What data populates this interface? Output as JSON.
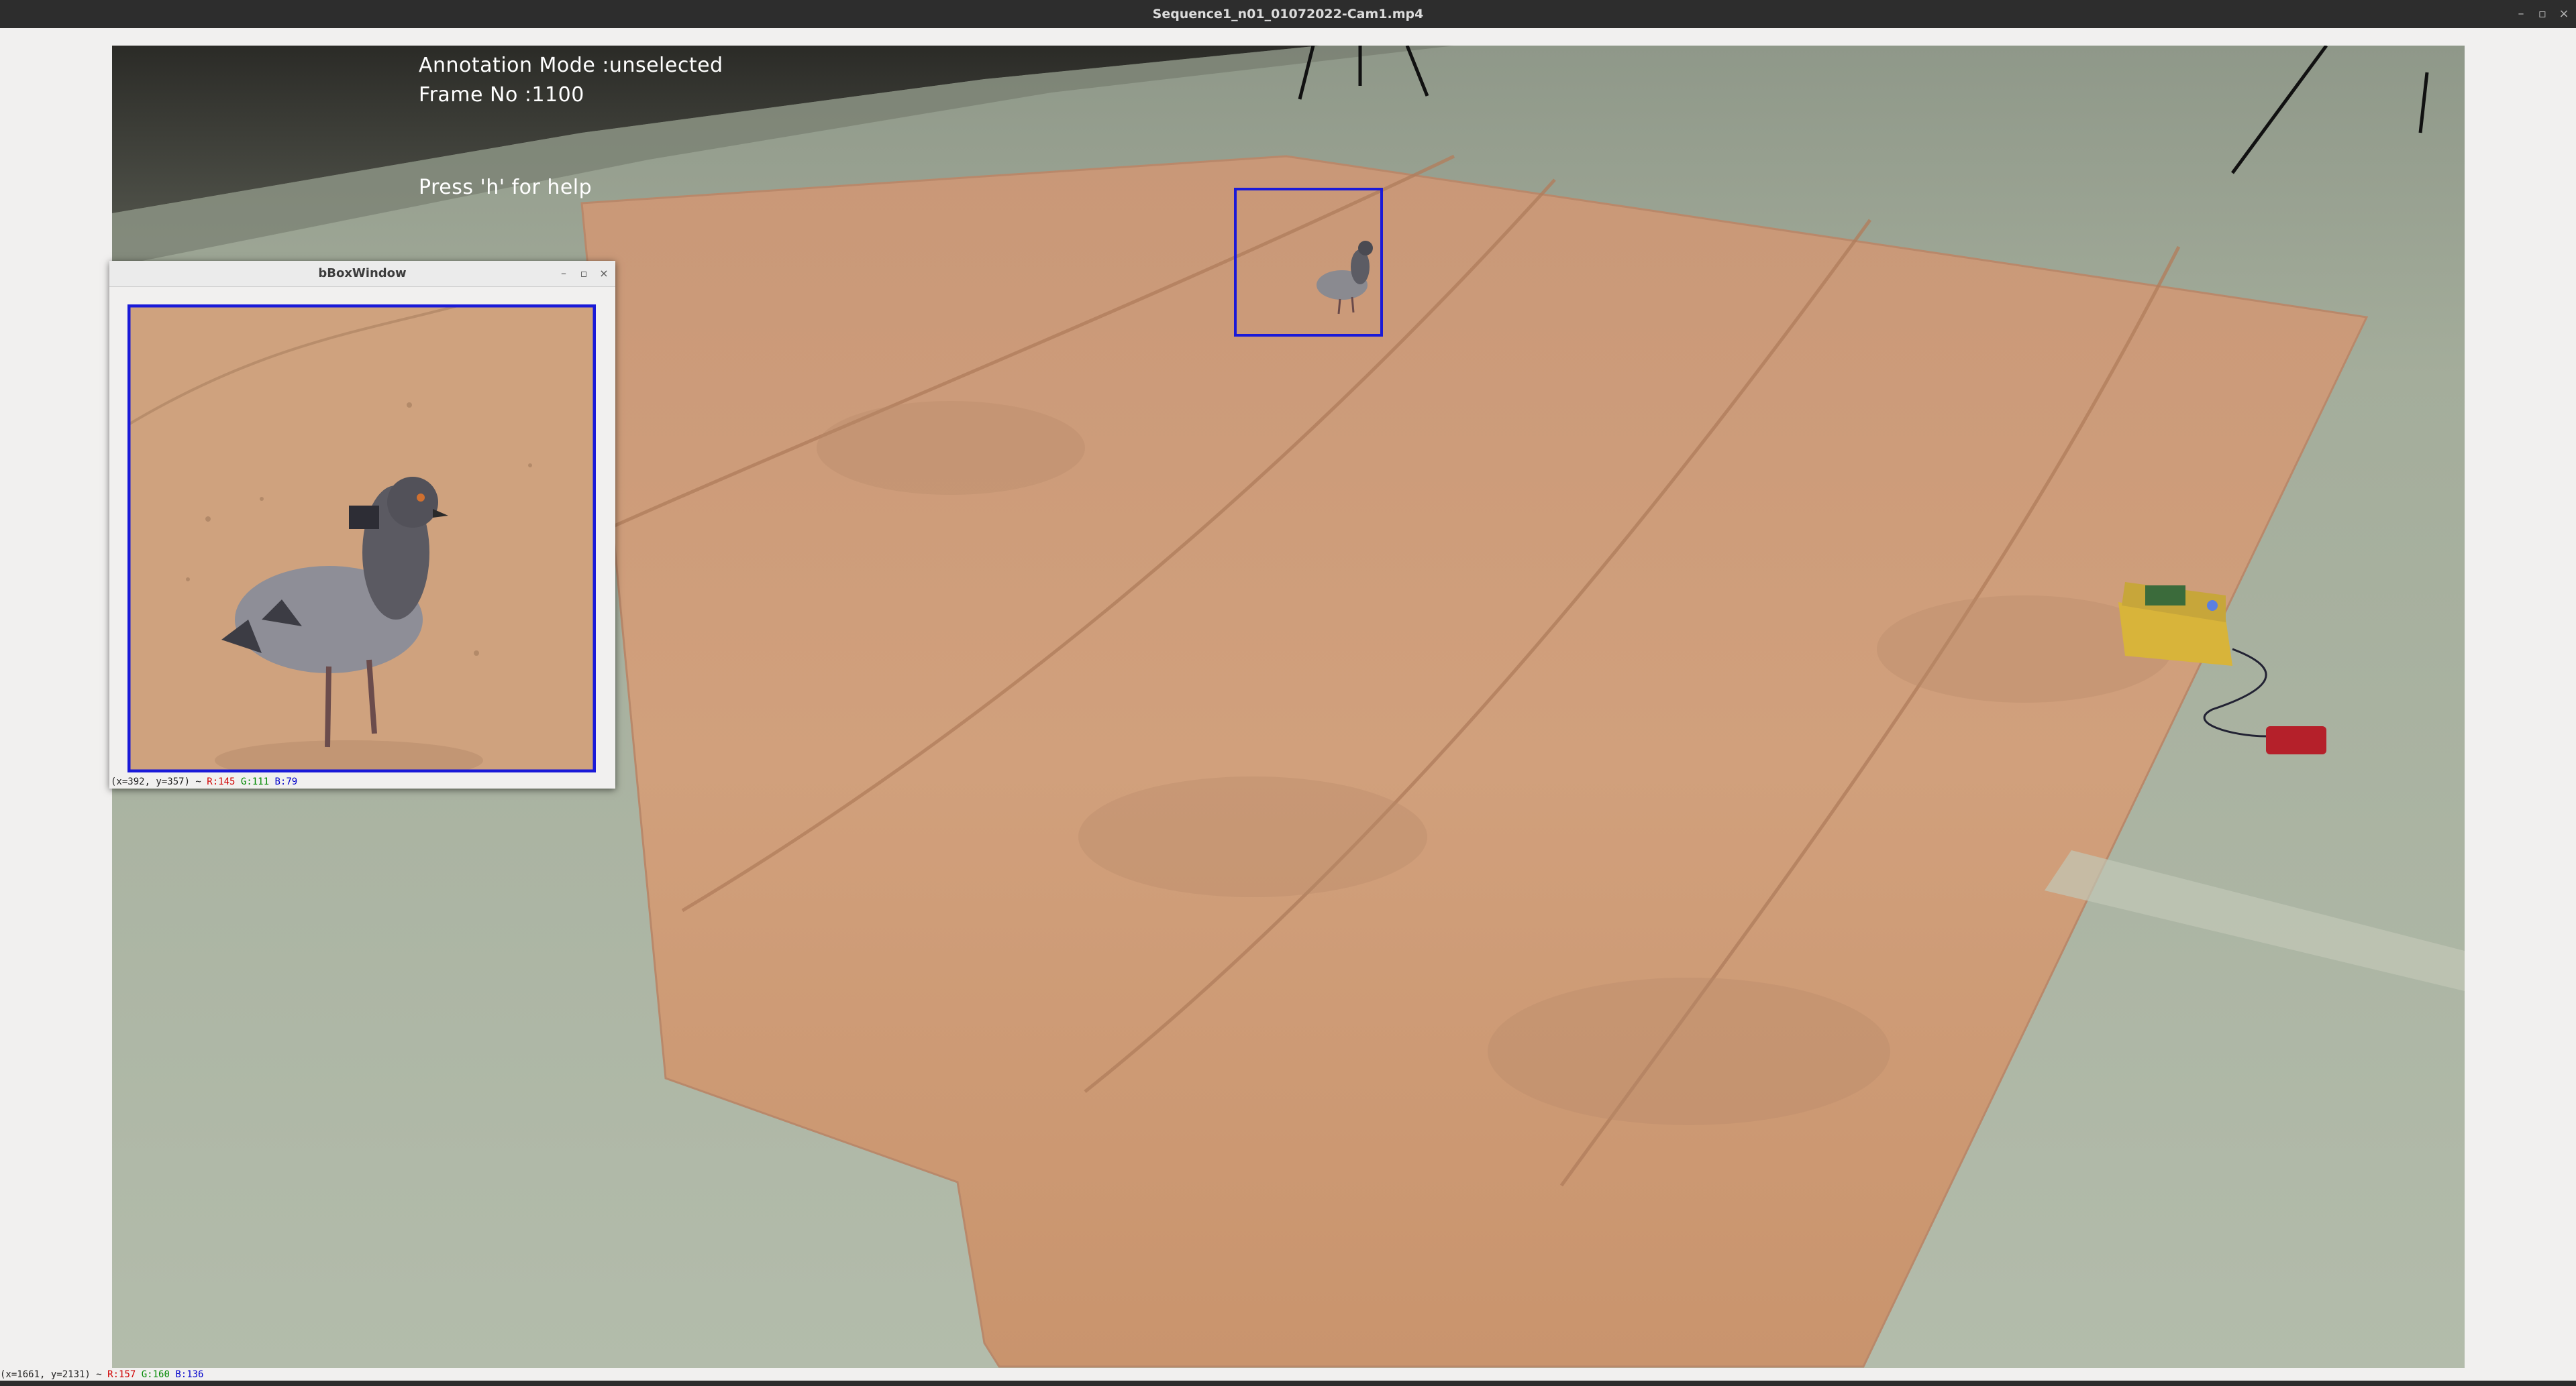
{
  "window": {
    "title": "Sequence1_n01_01072022-Cam1.mp4",
    "controls": {
      "minimize": "–",
      "maximize": "▫",
      "close": "×"
    }
  },
  "overlay": {
    "annotation_mode": "Annotation Mode :unselected",
    "frame_no": "Frame No :1100",
    "help_hint": "Press 'h' for help"
  },
  "bbox_window": {
    "title": "bBoxWindow",
    "controls": {
      "minimize": "–",
      "maximize": "▫",
      "close": "×"
    },
    "status": {
      "coords": "(x=392, y=357) ~",
      "r": "R:145",
      "g": "G:111",
      "b": "B:79"
    }
  },
  "status": {
    "coords": "(x=1661, y=2131) ~",
    "r": "R:157",
    "g": "G:160",
    "b": "B:136"
  },
  "colors": {
    "bbox_stroke": "#1a1ad8",
    "floor": "#aab3a1",
    "burlap": "#d2a27d",
    "titlebar": "#2d2d2d"
  },
  "icons": {
    "minimize": "minimize-icon",
    "maximize": "maximize-icon",
    "close": "close-icon"
  }
}
